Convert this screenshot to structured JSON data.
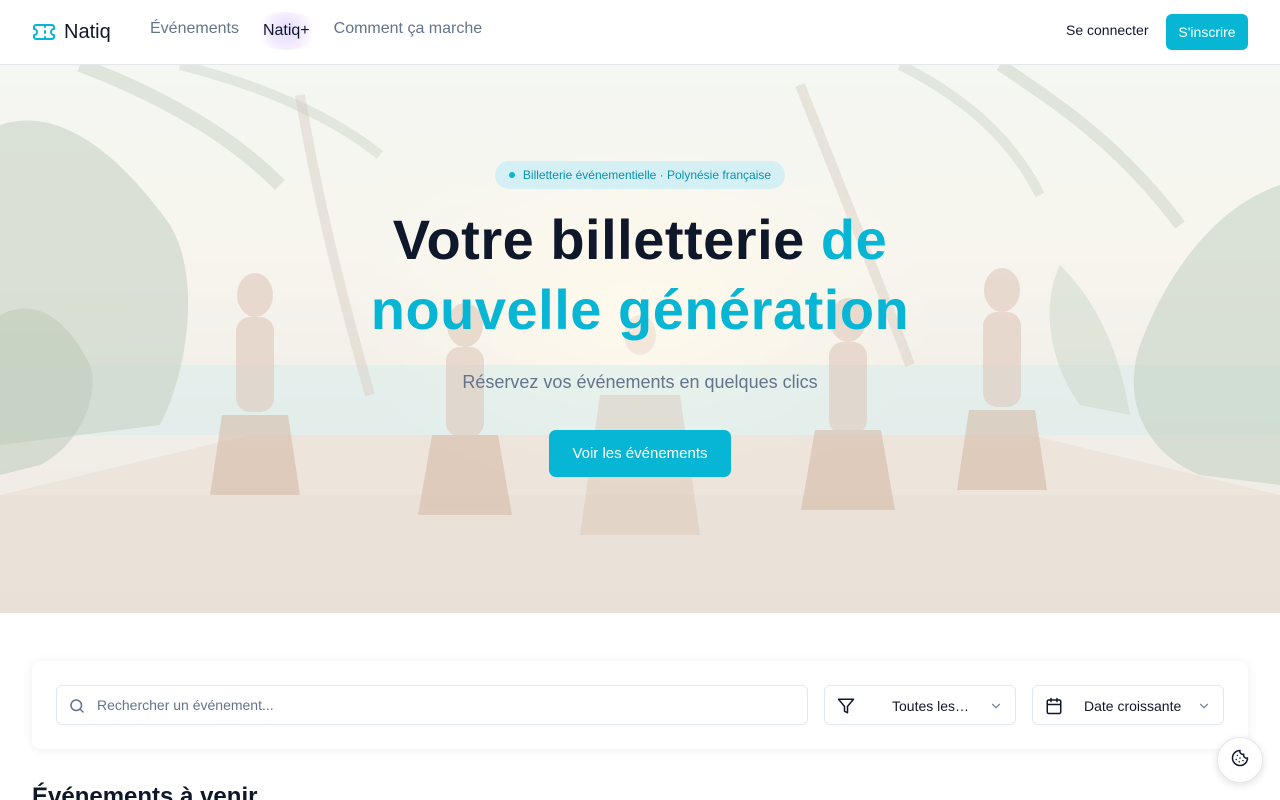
{
  "header": {
    "logo_text": "Natiq",
    "logo_icon": "ticket-icon",
    "nav": [
      {
        "label": "Événements"
      },
      {
        "label": "Natiq+"
      },
      {
        "label": "Comment ça marche"
      }
    ],
    "login_label": "Se connecter",
    "signup_label": "S'inscrire"
  },
  "hero": {
    "badge": "Billetterie événementielle · Polynésie française",
    "title_line1": "Votre billetterie",
    "title_accent_1": "de",
    "title_accent_2": "nouvelle génération",
    "subtitle": "Réservez vos événements en quelques clics",
    "cta_label": "Voir les événements"
  },
  "filters": {
    "search_placeholder": "Rechercher un événement...",
    "search_value": "",
    "search_icon": "search-icon",
    "category_value": "Toutes les…",
    "category_icon": "filter-icon",
    "sort_value": "Date croissante",
    "sort_icon": "calendar-icon"
  },
  "events": {
    "section_title": "Événements à venir"
  },
  "cookie_icon": "cookie-icon",
  "colors": {
    "accent": "#06b6d4",
    "text": "#0f172a",
    "muted": "#64748b",
    "border": "#e2e8f0"
  }
}
